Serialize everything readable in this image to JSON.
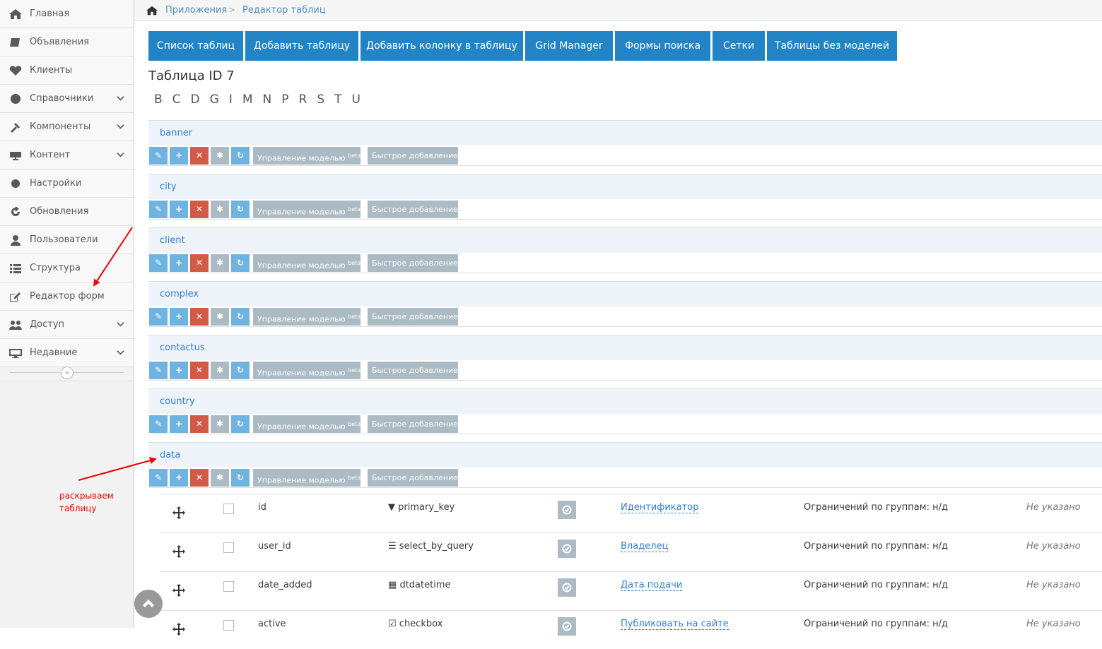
{
  "sidebar": {
    "items": [
      {
        "label": "Главная",
        "icon": "home-icon",
        "expandable": false
      },
      {
        "label": "Объявления",
        "icon": "book-icon",
        "expandable": false
      },
      {
        "label": "Клиенты",
        "icon": "heart-icon",
        "expandable": false
      },
      {
        "label": "Справочники",
        "icon": "globe-icon",
        "expandable": true
      },
      {
        "label": "Компоненты",
        "icon": "gavel-icon",
        "expandable": true
      },
      {
        "label": "Контент",
        "icon": "keyboard-icon",
        "expandable": true
      },
      {
        "label": "Настройки",
        "icon": "cog-icon",
        "expandable": false
      },
      {
        "label": "Обновления",
        "icon": "refresh-icon",
        "expandable": false
      },
      {
        "label": "Пользователи",
        "icon": "user-icon",
        "expandable": false
      },
      {
        "label": "Структура",
        "icon": "list-icon",
        "expandable": false
      },
      {
        "label": "Редактор форм",
        "icon": "edit-icon",
        "expandable": false
      },
      {
        "label": "Доступ",
        "icon": "users-icon",
        "expandable": true
      },
      {
        "label": "Недавние",
        "icon": "desktop-icon",
        "expandable": true
      }
    ],
    "collapse_glyph": "«"
  },
  "breadcrumb": {
    "items": [
      "Приложения",
      "Редактор таблиц"
    ],
    "separator": ">"
  },
  "toolbar": {
    "buttons": [
      "Список таблиц",
      "Добавить таблицу",
      "Добавить колонку в таблицу",
      "Grid Manager",
      "Формы поиска",
      "Сетки",
      "Таблицы без моделей"
    ]
  },
  "page_title": "Таблица ID 7",
  "letters": [
    "B",
    "C",
    "D",
    "G",
    "I",
    "M",
    "N",
    "P",
    "R",
    "S",
    "T",
    "U"
  ],
  "tables": [
    {
      "name": "banner"
    },
    {
      "name": "city"
    },
    {
      "name": "client"
    },
    {
      "name": "complex"
    },
    {
      "name": "contactus"
    },
    {
      "name": "country"
    },
    {
      "name": "data"
    }
  ],
  "table_tools": {
    "model_label": "Управление моделью",
    "model_badge": "beta",
    "quick_add_label": "Быстрое добавление"
  },
  "columns": [
    {
      "name": "id",
      "type": "primary_key",
      "type_icon": "filter-icon",
      "title": "Идентификатор",
      "groups": "Ограничений по группам: н/д",
      "note": "Не указано"
    },
    {
      "name": "user_id",
      "type": "select_by_query",
      "type_icon": "list-alt-icon",
      "title": "Владелец",
      "groups": "Ограничений по группам: н/д",
      "note": "Не указано"
    },
    {
      "name": "date_added",
      "type": "dtdatetime",
      "type_icon": "calendar-icon",
      "title": "Дата подачи",
      "groups": "Ограничений по группам: н/д",
      "note": "Не указано"
    },
    {
      "name": "active",
      "type": "checkbox",
      "type_icon": "check-square-icon",
      "title": "Публиковать на сайте",
      "groups": "Ограничений по группам: н/д",
      "note": "Не указано"
    }
  ],
  "annotation": {
    "text_line1": "раскрываем",
    "text_line2": "таблицу",
    "color": "#e00000"
  },
  "colors": {
    "accent": "#2283c5",
    "link": "#307ecc",
    "danger": "#d15b47",
    "muted": "#abbac3",
    "info": "#6fb3e0"
  }
}
